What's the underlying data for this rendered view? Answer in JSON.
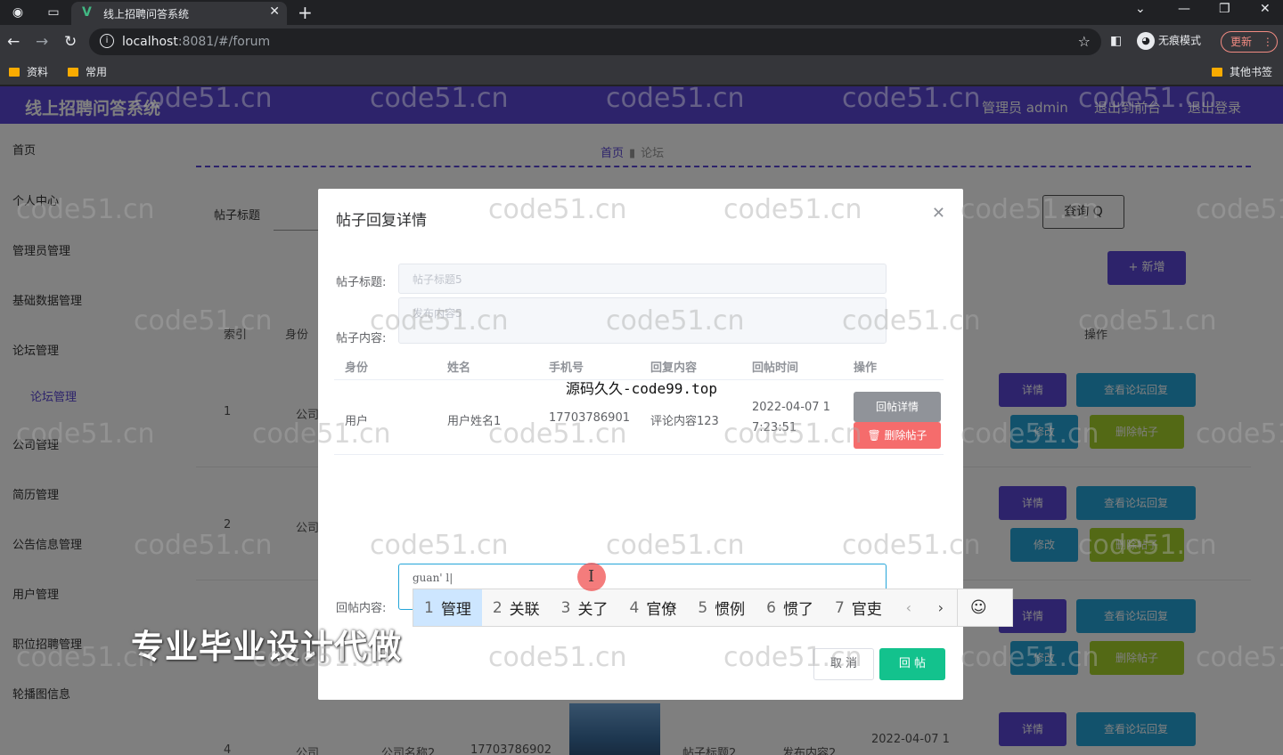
{
  "browser": {
    "tab_title": "线上招聘问答系统",
    "tab_favicon": "V",
    "url_host": "localhost",
    "url_path": ":8081/#/forum",
    "incognito_label": "无痕模式",
    "update_label": "更新",
    "bookmarks": [
      "资料",
      "常用"
    ],
    "other_bookmarks": "其他书签"
  },
  "app": {
    "title": "线上招聘问答系统",
    "header_links": [
      "管理员 admin",
      "退出到前台",
      "退出登录"
    ],
    "accent_color": "#5b47d6"
  },
  "sidebar": {
    "items": [
      "首页",
      "个人中心",
      "管理员管理",
      "基础数据管理",
      "论坛管理",
      "论坛管理",
      "公司管理",
      "简历管理",
      "公告信息管理",
      "用户管理",
      "职位招聘管理",
      "轮播图信息"
    ]
  },
  "main": {
    "breadcrumb": [
      "首页",
      "论坛"
    ],
    "search_label": "帖子标题",
    "query_button": "查询 Q",
    "new_button": "+ 新增",
    "columns": [
      "索引",
      "身份",
      "操作"
    ],
    "rows": [
      {
        "index": "1",
        "identity": "公司"
      },
      {
        "index": "2",
        "identity": "公司"
      },
      {
        "index": "4",
        "identity": "公司",
        "name": "公司名称2",
        "phone": "17703786902",
        "post_title": "帖子标题2",
        "post_content": "发布内容2",
        "time": "2022-04-07 1"
      }
    ],
    "actions": {
      "detail": "详情",
      "view_replies": "查看论坛回复",
      "edit": "修改",
      "delete_post": "删除帖子"
    }
  },
  "dialog": {
    "title": "帖子回复详情",
    "post_title_label": "帖子标题:",
    "post_title_value": "帖子标题5",
    "post_content_label": "帖子内容:",
    "post_content_value": "发布内容5",
    "columns": [
      "身份",
      "姓名",
      "手机号",
      "回复内容",
      "回帖时间",
      "操作"
    ],
    "reply_row": {
      "identity": "用户",
      "name": "用户姓名1",
      "phone": "17703786901",
      "content": "评论内容123",
      "time_line1": "2022-04-07 1",
      "time_line2": "7:23:51",
      "detail_button": "回帖详情",
      "delete_button": "删除帖子"
    },
    "overlay_note": "源码久久-code99.top",
    "reply_label": "回帖内容:",
    "reply_input_value": "guan' l|",
    "cancel_button": "取 消",
    "submit_button": "回 帖"
  },
  "ime": {
    "candidates": [
      {
        "n": "1",
        "text": "管理"
      },
      {
        "n": "2",
        "text": "关联"
      },
      {
        "n": "3",
        "text": "关了"
      },
      {
        "n": "4",
        "text": "官僚"
      },
      {
        "n": "5",
        "text": "惯例"
      },
      {
        "n": "6",
        "text": "惯了"
      },
      {
        "n": "7",
        "text": "官吏"
      }
    ],
    "emoji_icon": "☺"
  },
  "promo_text": "专业毕业设计代做",
  "watermark": "code51.cn"
}
